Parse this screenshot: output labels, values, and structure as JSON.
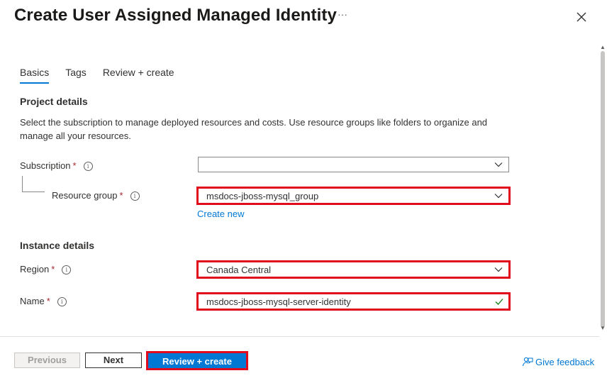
{
  "header": {
    "title": "Create User Assigned Managed Identity",
    "more_label": "···",
    "close_icon": "close-icon"
  },
  "tabs": [
    {
      "label": "Basics",
      "active": true
    },
    {
      "label": "Tags",
      "active": false
    },
    {
      "label": "Review + create",
      "active": false
    }
  ],
  "project_details": {
    "heading": "Project details",
    "description": "Select the subscription to manage deployed resources and costs. Use resource groups like folders to organize and manage all your resources.",
    "subscription": {
      "label": "Subscription",
      "required": "*",
      "value": ""
    },
    "resource_group": {
      "label": "Resource group",
      "required": "*",
      "value": "msdocs-jboss-mysql_group"
    },
    "create_new": "Create new"
  },
  "instance_details": {
    "heading": "Instance details",
    "region": {
      "label": "Region",
      "required": "*",
      "value": "Canada Central"
    },
    "name": {
      "label": "Name",
      "required": "*",
      "value": "msdocs-jboss-mysql-server-identity"
    }
  },
  "footer": {
    "previous": "Previous",
    "next": "Next",
    "review_create": "Review + create",
    "feedback": "Give feedback"
  },
  "colors": {
    "accent": "#0078d4",
    "highlight": "#e00b1c",
    "required": "#a4262c",
    "valid": "#107c10"
  }
}
